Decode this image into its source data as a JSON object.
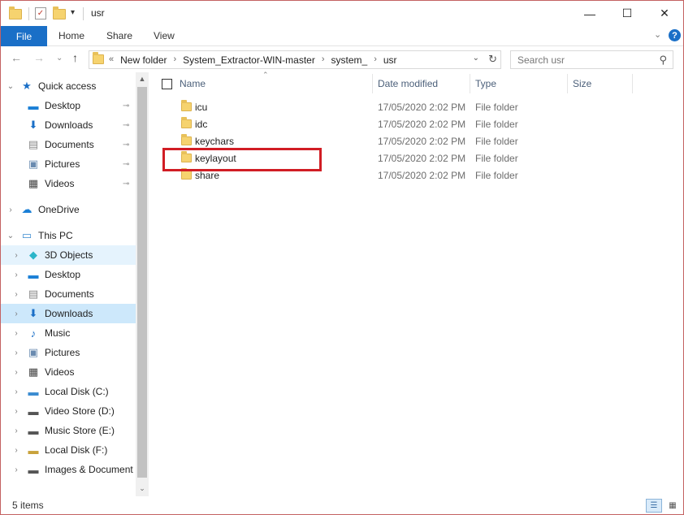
{
  "window": {
    "title": "usr",
    "controls": {
      "minimize": "—",
      "maximize": "☐",
      "close": "✕"
    }
  },
  "ribbon": {
    "file_label": "File",
    "tabs": [
      "Home",
      "Share",
      "View"
    ],
    "expand_glyph": "⌄",
    "help_glyph": "?"
  },
  "nav": {
    "back": "←",
    "forward": "→",
    "recent": "⌄",
    "up": "↑",
    "address": {
      "overflow": "«",
      "crumbs": [
        "New folder",
        "System_Extractor-WIN-master",
        "system_",
        "usr"
      ],
      "separator": "›",
      "dropdown": "⌄",
      "refresh": "↻"
    },
    "search": {
      "placeholder": "Search usr",
      "icon": "⚲"
    }
  },
  "sidebar": {
    "items": [
      {
        "label": "Quick access",
        "icon": "star-icon",
        "glyph": "★",
        "color": "#1a6fc7",
        "expanded": true,
        "level": 0
      },
      {
        "label": "Desktop",
        "icon": "desktop-icon",
        "glyph": "▬",
        "color": "#1a7fd6",
        "pinned": true,
        "level": 1
      },
      {
        "label": "Downloads",
        "icon": "download-arrow-icon",
        "glyph": "⬇",
        "color": "#1a6fc7",
        "pinned": true,
        "level": 1
      },
      {
        "label": "Documents",
        "icon": "documents-icon",
        "glyph": "▤",
        "color": "#888888",
        "pinned": true,
        "level": 1
      },
      {
        "label": "Pictures",
        "icon": "pictures-icon",
        "glyph": "▣",
        "color": "#6a8bb0",
        "pinned": true,
        "level": 1
      },
      {
        "label": "Videos",
        "icon": "videos-icon",
        "glyph": "▦",
        "color": "#444444",
        "pinned": true,
        "level": 1
      },
      {
        "label": "OneDrive",
        "icon": "cloud-icon",
        "glyph": "☁",
        "color": "#1a7fd6",
        "expanded": false,
        "level": 0
      },
      {
        "label": "This PC",
        "icon": "computer-icon",
        "glyph": "▭",
        "color": "#3a8bd0",
        "expanded": true,
        "level": 0
      },
      {
        "label": "3D Objects",
        "icon": "cube-icon",
        "glyph": "◆",
        "color": "#2bb5c9",
        "level": 1,
        "state": "hover"
      },
      {
        "label": "Desktop",
        "icon": "desktop-icon",
        "glyph": "▬",
        "color": "#1a7fd6",
        "level": 1
      },
      {
        "label": "Documents",
        "icon": "documents-icon",
        "glyph": "▤",
        "color": "#888888",
        "level": 1
      },
      {
        "label": "Downloads",
        "icon": "download-arrow-icon",
        "glyph": "⬇",
        "color": "#1a6fc7",
        "level": 1,
        "state": "selected"
      },
      {
        "label": "Music",
        "icon": "music-note-icon",
        "glyph": "♪",
        "color": "#1a6fc7",
        "level": 1
      },
      {
        "label": "Pictures",
        "icon": "pictures-icon",
        "glyph": "▣",
        "color": "#6a8bb0",
        "level": 1
      },
      {
        "label": "Videos",
        "icon": "videos-icon",
        "glyph": "▦",
        "color": "#444444",
        "level": 1
      },
      {
        "label": "Local Disk (C:)",
        "icon": "windows-drive-icon",
        "glyph": "▬",
        "color": "#3a8bd0",
        "level": 1
      },
      {
        "label": "Video Store (D:)",
        "icon": "drive-icon",
        "glyph": "▬",
        "color": "#555555",
        "level": 1
      },
      {
        "label": "Music Store (E:)",
        "icon": "drive-icon",
        "glyph": "▬",
        "color": "#555555",
        "level": 1
      },
      {
        "label": "Local Disk (F:)",
        "icon": "lock-drive-icon",
        "glyph": "▬",
        "color": "#c8a23c",
        "level": 1
      },
      {
        "label": "Images & Document",
        "icon": "drive-icon",
        "glyph": "▬",
        "color": "#555555",
        "level": 1
      }
    ],
    "pin_glyph": "📌",
    "chevron_expanded": "⌄",
    "chevron_collapsed": "›",
    "scroll_up": "▲",
    "scroll_down": "⌄"
  },
  "columns": {
    "name": "Name",
    "date": "Date modified",
    "type": "Type",
    "size": "Size",
    "sort_glyph": "⌃"
  },
  "files": [
    {
      "name": "icu",
      "date": "17/05/2020 2:02 PM",
      "type": "File folder"
    },
    {
      "name": "idc",
      "date": "17/05/2020 2:02 PM",
      "type": "File folder"
    },
    {
      "name": "keychars",
      "date": "17/05/2020 2:02 PM",
      "type": "File folder"
    },
    {
      "name": "keylayout",
      "date": "17/05/2020 2:02 PM",
      "type": "File folder",
      "highlighted": true
    },
    {
      "name": "share",
      "date": "17/05/2020 2:02 PM",
      "type": "File folder"
    }
  ],
  "status": {
    "count": "5 items",
    "details_view_glyph": "☰",
    "icons_view_glyph": "▦"
  },
  "colors": {
    "accent": "#1a6fc7",
    "highlight_box": "#d11d24",
    "selected_bg": "#cde8fb",
    "hover_bg": "#e5f3fd"
  }
}
